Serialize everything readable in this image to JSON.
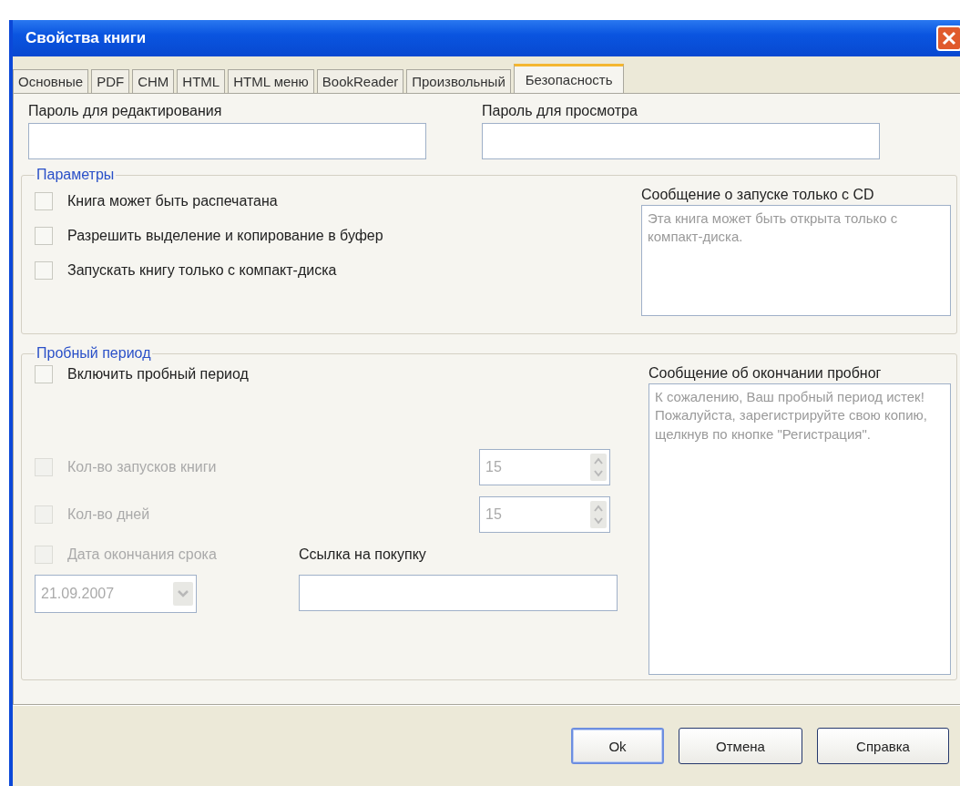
{
  "window": {
    "title": "Свойства книги"
  },
  "tabs": [
    {
      "label": "Основные",
      "selected": false
    },
    {
      "label": "PDF",
      "selected": false
    },
    {
      "label": "CHM",
      "selected": false
    },
    {
      "label": "HTML",
      "selected": false
    },
    {
      "label": "HTML меню",
      "selected": false
    },
    {
      "label": "BookReader",
      "selected": false
    },
    {
      "label": "Произвольный",
      "selected": false
    },
    {
      "label": "Безопасность",
      "selected": true
    }
  ],
  "password_fields": [
    {
      "label": "Пароль для редактирования"
    },
    {
      "label": "Пароль для просмотра"
    }
  ],
  "options_group": {
    "title": "Параметры",
    "checkboxes": [
      {
        "label": "Книга может быть распечатана",
        "checked": false
      },
      {
        "label": "Разрешить выделение и копирование в буфер",
        "checked": false
      },
      {
        "label": "Запускать книгу только с компакт-диска",
        "checked": false
      }
    ],
    "cd_message": {
      "label": "Сообщение о запуске только с CD",
      "text": "Эта книга может быть открыта только с компакт-диска."
    }
  },
  "trial_group": {
    "title": "Пробный период",
    "enable": {
      "label": "Включить пробный период",
      "checked": false
    },
    "limits": [
      {
        "label": "Кол-во запусков книги",
        "checked": false,
        "disabled": true,
        "value": "15"
      },
      {
        "label": "Кол-во дней",
        "checked": false,
        "disabled": true,
        "value": "15"
      }
    ],
    "end_date": {
      "label": "Дата окончания срока",
      "checked": false,
      "disabled": true,
      "value": "21.09.2007"
    },
    "purchase_link": {
      "label": "Ссылка на покупку"
    },
    "expiry_message": {
      "label": "Сообщение об окончании пробног",
      "text": "К сожалению, Ваш пробный период истек! Пожалуйста, зарегистрируйте свою копию, щелкнув по кнопке \"Регистрация\"."
    }
  },
  "buttons": [
    {
      "label": "Ok",
      "default": true
    },
    {
      "label": "Отмена",
      "default": false
    },
    {
      "label": "Справка",
      "default": false
    }
  ]
}
